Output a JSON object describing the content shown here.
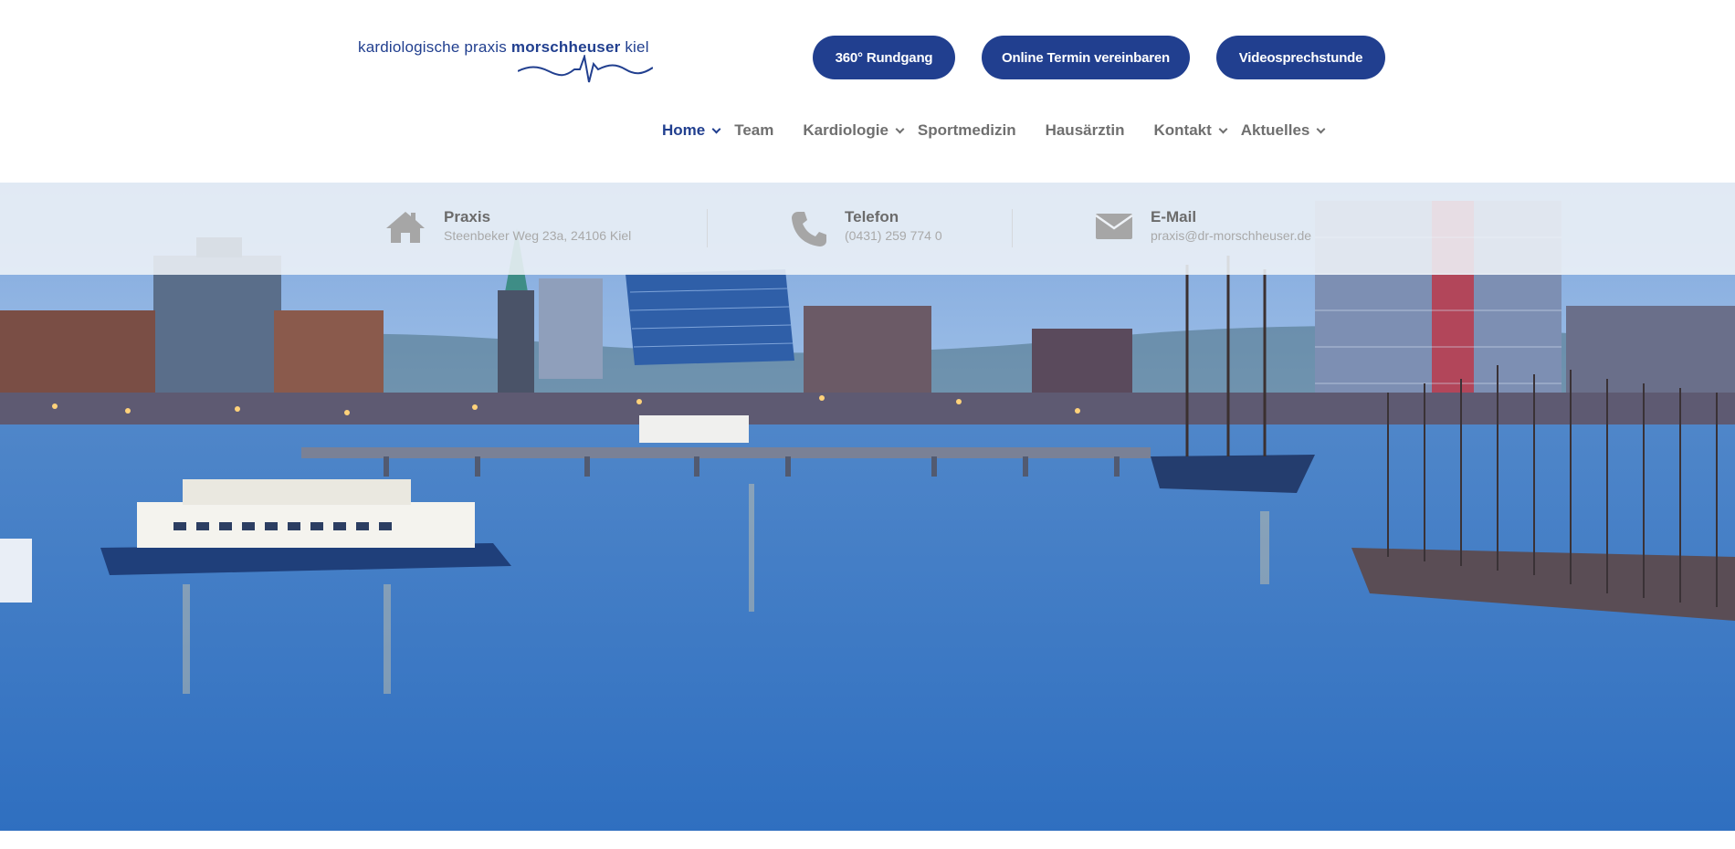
{
  "logo": {
    "text_light": "kardiologische praxis ",
    "text_bold": "morschheuser",
    "text_city": " kiel"
  },
  "top_buttons": {
    "rundgang": "360° Rundgang",
    "termin": "Online Termin vereinbaren",
    "video": "Videosprechstunde"
  },
  "nav": {
    "items": [
      {
        "label": "Home",
        "dropdown": true,
        "active": true
      },
      {
        "label": "Team",
        "dropdown": false,
        "active": false
      },
      {
        "label": "Kardiologie",
        "dropdown": true,
        "active": false
      },
      {
        "label": "Sportmedizin",
        "dropdown": false,
        "active": false
      },
      {
        "label": "Hausärztin",
        "dropdown": false,
        "active": false
      },
      {
        "label": "Kontakt",
        "dropdown": true,
        "active": false
      },
      {
        "label": "Aktuelles",
        "dropdown": true,
        "active": false
      }
    ]
  },
  "info": {
    "praxis": {
      "title": "Praxis",
      "value": "Steenbeker Weg 23a, 24106 Kiel",
      "icon": "home-icon"
    },
    "telefon": {
      "title": "Telefon",
      "value": "(0431) 259 774 0",
      "icon": "phone-icon"
    },
    "email": {
      "title": "E-Mail",
      "value": "praxis@dr-morschheuser.de",
      "icon": "envelope-icon"
    }
  },
  "colors": {
    "brand": "#213f8f",
    "nav_text": "#6f6f6f",
    "info_title": "#6b6b6b",
    "info_value": "#a9a9a9",
    "icon_gray": "#a6a6a6"
  }
}
